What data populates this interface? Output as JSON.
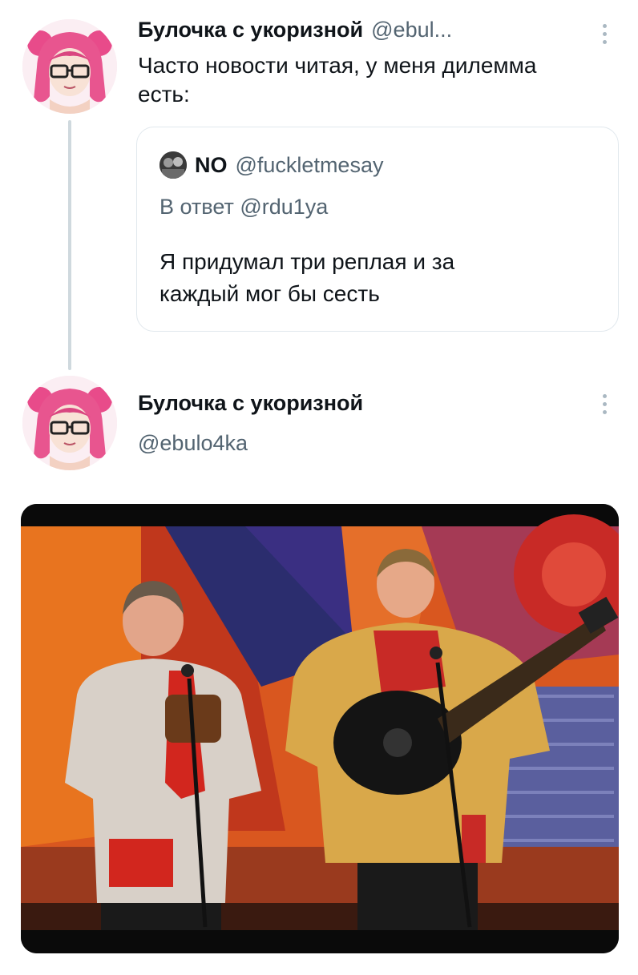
{
  "tweet1": {
    "author_name": "Булочка с укоризной",
    "author_handle": "@ebul...",
    "text_line1": "Часто новости читая, у меня дилемма",
    "text_line2": "есть:",
    "avatar_icon": "anime-girl-avatar",
    "more_icon": "vertical-dots-icon"
  },
  "quote": {
    "author_name": "NO",
    "author_handle": "@fuckletmesay",
    "reply_to": "В ответ @rdu1ya",
    "text_line1": "Я придумал три реплая и за",
    "text_line2": "каждый мог бы сесть",
    "avatar_icon": "photo-avatar"
  },
  "tweet2": {
    "author_name": "Булочка с укоризной",
    "author_handle": "@ebulo4ka",
    "avatar_icon": "anime-girl-avatar",
    "more_icon": "vertical-dots-icon",
    "media_description_icon": "two-folk-musicians-photo"
  },
  "colors": {
    "text": "#0f1419",
    "secondary": "#536471",
    "border": "#e1e8ed",
    "thread_line": "#cfd9de"
  }
}
